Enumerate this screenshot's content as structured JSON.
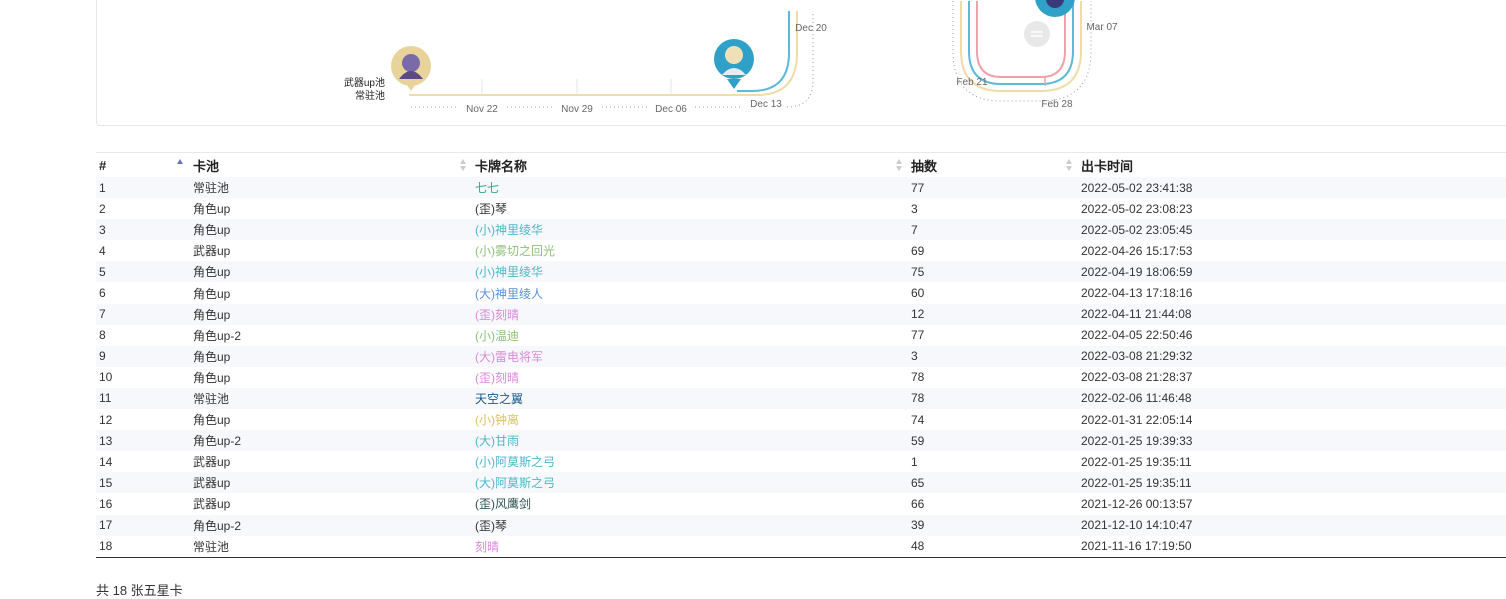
{
  "timeline": {
    "legend": [
      "武器up池",
      "常驻池"
    ],
    "left_dates": [
      "Nov 22",
      "Nov 29",
      "Dec 06",
      "Dec 13",
      "Dec 20"
    ],
    "right_dates": [
      "Feb 21",
      "Feb 28",
      "Mar 07"
    ],
    "colors": {
      "weapon": "#f0dca8",
      "standard": "#5bbad5",
      "char": "#f0a0a8"
    }
  },
  "table": {
    "headers": {
      "idx": "#",
      "pool": "卡池",
      "name": "卡牌名称",
      "pulls": "抽数",
      "time": "出卡时间"
    },
    "rows": [
      {
        "idx": "1",
        "pool": "常驻池",
        "name": "七七",
        "name_color": "#33aa88",
        "pulls": "77",
        "time": "2022-05-02 23:41:38"
      },
      {
        "idx": "2",
        "pool": "角色up",
        "name": "(歪)琴",
        "name_color": "#333333",
        "pulls": "3",
        "time": "2022-05-02 23:08:23"
      },
      {
        "idx": "3",
        "pool": "角色up",
        "name": "(小)神里绫华",
        "name_color": "#4bb8c8",
        "pulls": "7",
        "time": "2022-05-02 23:05:45"
      },
      {
        "idx": "4",
        "pool": "武器up",
        "name": "(小)雾切之回光",
        "name_color": "#8fc07a",
        "pulls": "69",
        "time": "2022-04-26 15:17:53"
      },
      {
        "idx": "5",
        "pool": "角色up",
        "name": "(小)神里绫华",
        "name_color": "#4bb8c8",
        "pulls": "75",
        "time": "2022-04-19 18:06:59"
      },
      {
        "idx": "6",
        "pool": "角色up",
        "name": "(大)神里绫人",
        "name_color": "#5b8fd6",
        "pulls": "60",
        "time": "2022-04-13 17:18:16"
      },
      {
        "idx": "7",
        "pool": "角色up",
        "name": "(歪)刻晴",
        "name_color": "#d98ad9",
        "pulls": "12",
        "time": "2022-04-11 21:44:08"
      },
      {
        "idx": "8",
        "pool": "角色up-2",
        "name": "(小)温迪",
        "name_color": "#8fc07a",
        "pulls": "77",
        "time": "2022-04-05 22:50:46"
      },
      {
        "idx": "9",
        "pool": "角色up",
        "name": "(大)雷电将军",
        "name_color": "#d98ad9",
        "pulls": "3",
        "time": "2022-03-08 21:29:32"
      },
      {
        "idx": "10",
        "pool": "角色up",
        "name": "(歪)刻晴",
        "name_color": "#d98ad9",
        "pulls": "78",
        "time": "2022-03-08 21:28:37"
      },
      {
        "idx": "11",
        "pool": "常驻池",
        "name": "天空之翼",
        "name_color": "#1a5a8a",
        "pulls": "78",
        "time": "2022-02-06 11:46:48"
      },
      {
        "idx": "12",
        "pool": "角色up",
        "name": "(小)钟离",
        "name_color": "#e0c060",
        "pulls": "74",
        "time": "2022-01-31 22:05:14"
      },
      {
        "idx": "13",
        "pool": "角色up-2",
        "name": "(大)甘雨",
        "name_color": "#4bb8c8",
        "pulls": "59",
        "time": "2022-01-25 19:39:33"
      },
      {
        "idx": "14",
        "pool": "武器up",
        "name": "(小)阿莫斯之弓",
        "name_color": "#4bb8c8",
        "pulls": "1",
        "time": "2022-01-25 19:35:11"
      },
      {
        "idx": "15",
        "pool": "武器up",
        "name": "(大)阿莫斯之弓",
        "name_color": "#4bb8c8",
        "pulls": "65",
        "time": "2022-01-25 19:35:11"
      },
      {
        "idx": "16",
        "pool": "武器up",
        "name": "(歪)风鹰剑",
        "name_color": "#2e5050",
        "pulls": "66",
        "time": "2021-12-26 00:13:57"
      },
      {
        "idx": "17",
        "pool": "角色up-2",
        "name": "(歪)琴",
        "name_color": "#333333",
        "pulls": "39",
        "time": "2021-12-10 14:10:47"
      },
      {
        "idx": "18",
        "pool": "常驻池",
        "name": "刻晴",
        "name_color": "#d98ad9",
        "pulls": "48",
        "time": "2021-11-16 17:19:50"
      }
    ]
  },
  "footer": "共 18 张五星卡"
}
